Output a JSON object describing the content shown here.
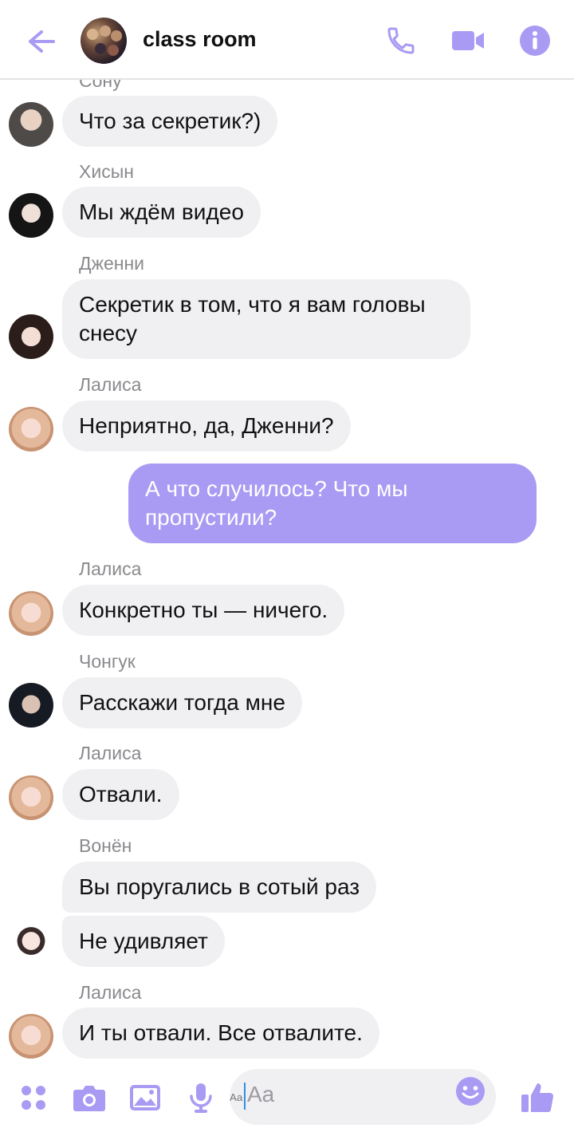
{
  "header": {
    "title": "class room",
    "colors": {
      "accent": "#a99bf3",
      "icon": "#a99bf3"
    },
    "icons": [
      "back-arrow-icon",
      "group-avatar",
      "phone-icon",
      "video-camera-icon",
      "info-icon"
    ]
  },
  "messages": [
    {
      "sender": "Сону",
      "text": "Что за секретик?)"
    },
    {
      "sender": "Хисын",
      "text": "Мы ждём видео"
    },
    {
      "sender": "Дженни",
      "text": "Секретик в том, что я вам головы снесу"
    },
    {
      "sender": "Лалиса",
      "text": "Неприятно, да, Дженни?"
    },
    {
      "mine": true,
      "text": "А что случилось? Что мы пропустили?"
    },
    {
      "sender": "Лалиса",
      "text": "Конкретно ты — ничего."
    },
    {
      "sender": "Чонгук",
      "text": "Расскажи тогда мне"
    },
    {
      "sender": "Лалиса",
      "text": "Отвали."
    },
    {
      "sender": "Вонён",
      "text": "Вы поругались в сотый раз"
    },
    {
      "sender": "Вонён",
      "text": "Не удивляет"
    },
    {
      "sender": "Лалиса",
      "text": "И ты отвали. Все отвалите."
    }
  ],
  "composer": {
    "placeholder": "Aa",
    "icons": [
      "more-icon",
      "camera-icon",
      "gallery-icon",
      "microphone-icon",
      "emoji-icon",
      "thumbs-up-icon"
    ]
  }
}
